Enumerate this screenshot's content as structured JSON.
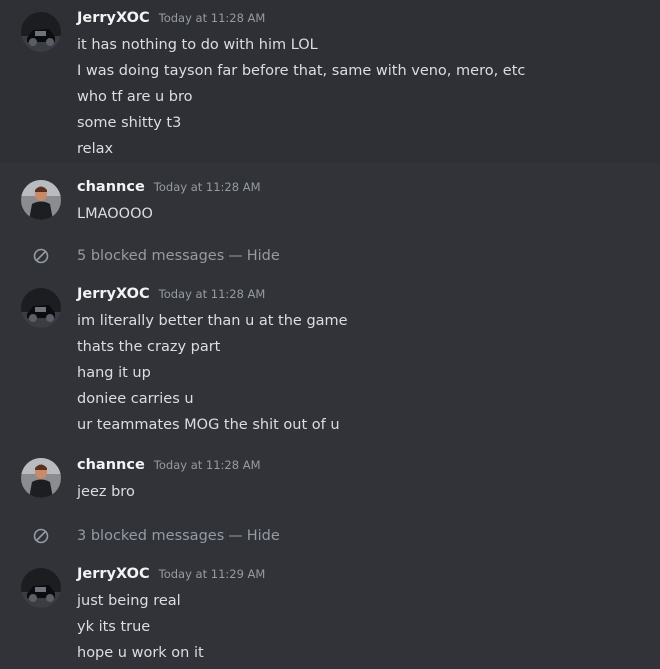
{
  "users": {
    "jerry": "JerryXOC",
    "chance": "channce"
  },
  "groups": [
    {
      "username": "JerryXOC",
      "timestamp": "Today at 11:28 AM",
      "avatar": "dark-car-avatar",
      "lines": [
        "it has nothing to do with him LOL",
        "I was doing tayson far before that, same with veno, mero, etc",
        "who tf are u bro",
        "some shitty t3",
        "relax"
      ]
    },
    {
      "username": "channce",
      "timestamp": "Today at 11:28 AM",
      "avatar": "person-photo-avatar",
      "lines": [
        "LMAOOOO"
      ]
    },
    {
      "username": "JerryXOC",
      "timestamp": "Today at 11:28 AM",
      "avatar": "dark-car-avatar",
      "lines": [
        "im literally better than u at the game",
        "thats the crazy part",
        "hang it up",
        "doniee carries u",
        "ur teammates MOG the shit out of u"
      ]
    },
    {
      "username": "channce",
      "timestamp": "Today at 11:28 AM",
      "avatar": "person-photo-avatar",
      "lines": [
        "jeez bro"
      ]
    },
    {
      "username": "JerryXOC",
      "timestamp": "Today at 11:29 AM",
      "avatar": "dark-car-avatar",
      "lines": [
        "just being real",
        "yk its true",
        "hope u work on it"
      ]
    }
  ],
  "blocked": [
    {
      "text": "5 blocked messages",
      "dash": "—",
      "action": "Hide"
    },
    {
      "text": "3 blocked messages",
      "dash": "—",
      "action": "Hide"
    }
  ],
  "colors": {
    "background": "#313338",
    "highlight": "#2e3035",
    "username": "#f2f3f5",
    "text": "#dbdee1",
    "muted": "#949ba4"
  },
  "icons": {
    "blocked": "ban-icon"
  }
}
